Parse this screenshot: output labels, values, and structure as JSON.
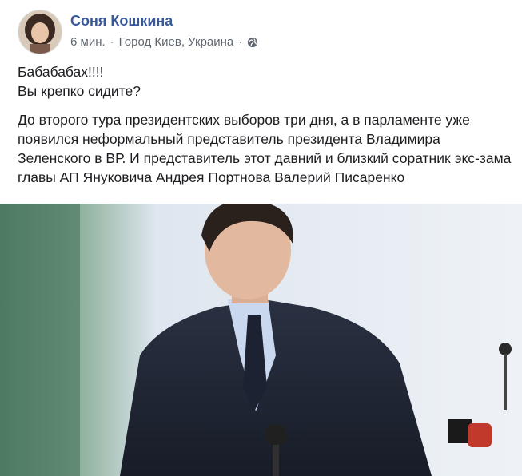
{
  "post": {
    "author": "Соня Кошкина",
    "time": "6 мин.",
    "separator": "·",
    "location": "Город Киев, Украина",
    "privacy_icon": "globe-icon",
    "text_line1": "Бабабабах!!!!",
    "text_line2": "Вы крепко сидите?",
    "text_paragraph": "До второго тура президентских выборов три дня, а в парламенте уже появился неформальный представитель президента Владимира Зеленского в ВР. И представитель этот давний и близкий соратник экс-зама главы АП Януковича Андрея Портнова Валерий Писаренко"
  },
  "colors": {
    "author": "#385898",
    "meta": "#606770",
    "text": "#1c1e21"
  }
}
